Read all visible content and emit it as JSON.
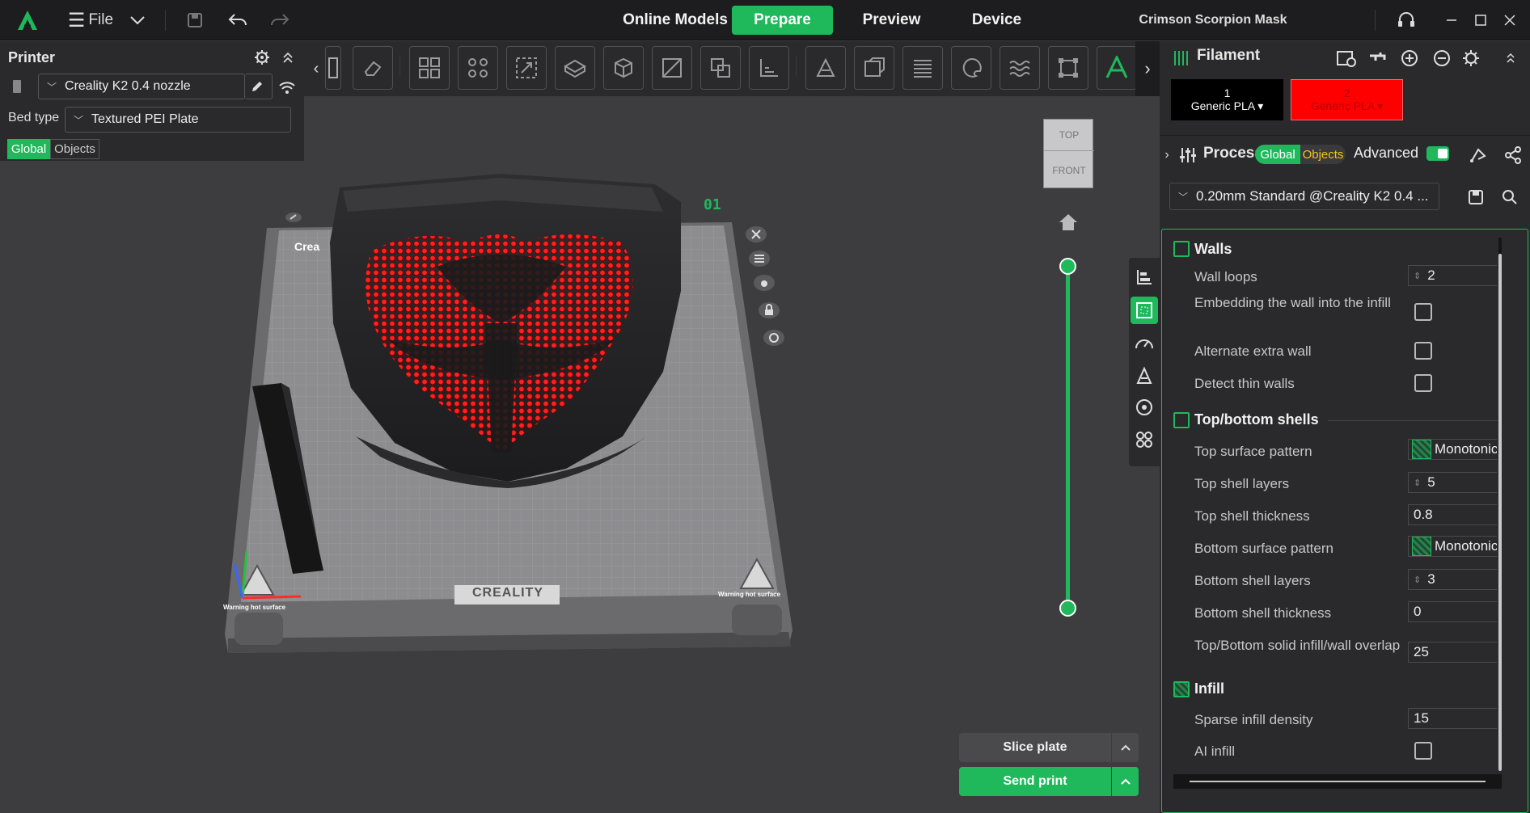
{
  "titlebar": {
    "menu_label": "File",
    "tabs": [
      {
        "label": "Online Models",
        "active": false
      },
      {
        "label": "Prepare",
        "active": true
      },
      {
        "label": "Preview",
        "active": false
      },
      {
        "label": "Device",
        "active": false
      }
    ],
    "project_title": "Crimson Scorpion Mask",
    "accent": "#1fb95c"
  },
  "printer_panel": {
    "title": "Printer",
    "printer_name": "Creality K2 0.4 nozzle",
    "bed_type_label": "Bed type",
    "bed_type_value": "Textured PEI Plate",
    "scope_tabs": [
      {
        "label": "Global",
        "active": true
      },
      {
        "label": "Objects",
        "active": false
      }
    ]
  },
  "viewport": {
    "plate_number": "01",
    "plate_brand": "CREALITY",
    "plate_label_partial": "Crea",
    "warning_text": "Warning hot surface",
    "view_cube_top": "TOP",
    "view_cube_front": "FRONT"
  },
  "actions": {
    "slice_label": "Slice plate",
    "send_label": "Send print"
  },
  "filament_panel": {
    "title": "Filament",
    "slots": [
      {
        "index": "1",
        "name": "Generic PLA",
        "color": "#000000"
      },
      {
        "index": "2",
        "name": "Generic PLA",
        "color": "#ff0000"
      }
    ]
  },
  "process_panel": {
    "title": "Process",
    "scope_tabs": [
      {
        "label": "Global",
        "active": true
      },
      {
        "label": "Objects",
        "active": false
      }
    ],
    "advanced_label": "Advanced",
    "advanced_enabled": true,
    "preset": "0.20mm Standard @Creality K2 0.4 ..."
  },
  "settings": {
    "walls": {
      "title": "Walls",
      "wall_loops": {
        "label": "Wall loops",
        "value": "2"
      },
      "embedding": {
        "label": "Embedding the wall into the infill",
        "checked": false
      },
      "alternate": {
        "label": "Alternate extra wall",
        "checked": false
      },
      "thin_walls": {
        "label": "Detect thin walls",
        "checked": false
      }
    },
    "shells": {
      "title": "Top/bottom shells",
      "top_pattern": {
        "label": "Top surface pattern",
        "value": "Monotonic"
      },
      "top_layers": {
        "label": "Top shell layers",
        "value": "5"
      },
      "top_thickness": {
        "label": "Top shell thickness",
        "value": "0.8"
      },
      "bottom_pattern": {
        "label": "Bottom surface pattern",
        "value": "Monotonic"
      },
      "bottom_layers": {
        "label": "Bottom shell layers",
        "value": "3"
      },
      "bottom_thickness": {
        "label": "Bottom shell thickness",
        "value": "0"
      },
      "overlap": {
        "label": "Top/Bottom solid infill/wall overlap",
        "value": "25"
      }
    },
    "infill": {
      "title": "Infill",
      "density": {
        "label": "Sparse infill density",
        "value": "15"
      },
      "ai_infill": {
        "label": "AI infill",
        "checked": false
      }
    }
  }
}
